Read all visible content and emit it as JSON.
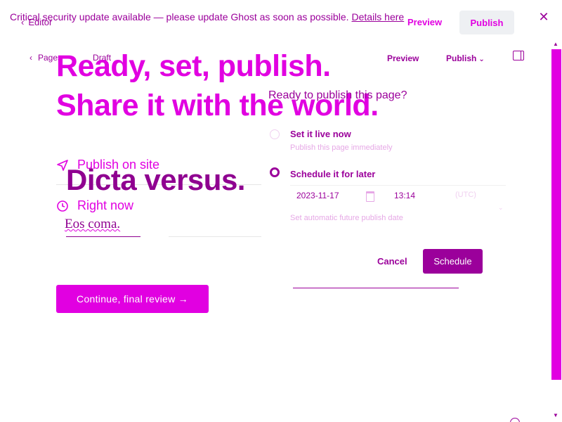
{
  "banner": {
    "text": "Critical security update available — please update Ghost as soon as possible.",
    "link": "Details here"
  },
  "editor_bar": {
    "back_label": "Editor",
    "preview_label": "Preview",
    "publish_label": "Publish",
    "close_icon": "close-icon"
  },
  "crumbs": {
    "pages_label": "Pages",
    "status_label": "Draft"
  },
  "publish_row": {
    "preview_label": "Preview",
    "publish_label": "Publish"
  },
  "headline": {
    "line1": "Ready, set, publish.",
    "line2": "Share it with the world."
  },
  "settings": {
    "publish_on": "Publish on site",
    "when": "Right now"
  },
  "post": {
    "title": "Dicta versus.",
    "body": "Eos coma."
  },
  "continue_label": "Continue, final review →",
  "panel": {
    "question": "Ready to publish this page?",
    "option_now_title": "Set it live now",
    "option_now_sub": "Publish this page immediately",
    "option_later_title": "Schedule it for later",
    "date": "2023-11-17",
    "time": "13:14",
    "timezone": "(UTC)",
    "schedule_hint": "Set automatic future publish date",
    "cancel_label": "Cancel",
    "schedule_label": "Schedule",
    "selected_option": "Schedule it for later"
  },
  "colors": {
    "accent": "#e100e1",
    "dark_accent": "#9b009b",
    "title_purple": "#8f0090"
  }
}
